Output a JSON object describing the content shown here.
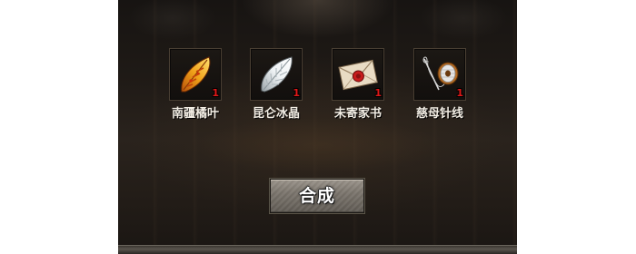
{
  "materials": [
    {
      "name": "南疆橘叶",
      "count": "1",
      "icon": "orange-leaf-icon"
    },
    {
      "name": "昆仑冰晶",
      "count": "1",
      "icon": "ice-crystal-icon"
    },
    {
      "name": "未寄家书",
      "count": "1",
      "icon": "sealed-letter-icon"
    },
    {
      "name": "慈母针线",
      "count": "1",
      "icon": "needle-thread-icon"
    }
  ],
  "combine_button": {
    "label": "合成"
  },
  "colors": {
    "count_text": "#e01818",
    "name_text": "#f2ede4",
    "panel_bg": "#221c17"
  }
}
